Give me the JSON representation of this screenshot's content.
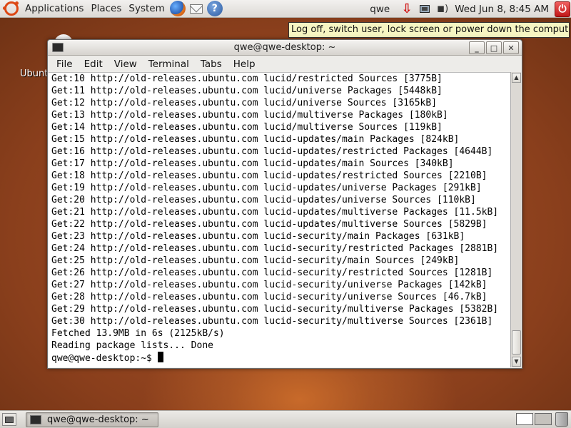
{
  "top_panel": {
    "menus": [
      "Applications",
      "Places",
      "System"
    ],
    "launchers": [
      "firefox-icon",
      "mail-icon",
      "help-icon"
    ],
    "user": "qwe",
    "clock": "Wed Jun  8,  8:45 AM",
    "tray_icons": [
      "download-arrow-icon",
      "network-icon",
      "volume-icon"
    ],
    "power_button": "shutdown-icon",
    "tooltip": "Log off, switch user, lock screen or power down the computer"
  },
  "desktop": {
    "icon_label": "Ubuntu"
  },
  "window": {
    "title": "qwe@qwe-desktop: ~",
    "menu": {
      "file": "File",
      "edit": "Edit",
      "view": "View",
      "terminal": "Terminal",
      "tabs": "Tabs",
      "help": "Help"
    },
    "lines": [
      "Get:10 http://old-releases.ubuntu.com lucid/restricted Sources [3775B]",
      "Get:11 http://old-releases.ubuntu.com lucid/universe Packages [5448kB]",
      "Get:12 http://old-releases.ubuntu.com lucid/universe Sources [3165kB]",
      "Get:13 http://old-releases.ubuntu.com lucid/multiverse Packages [180kB]",
      "Get:14 http://old-releases.ubuntu.com lucid/multiverse Sources [119kB]",
      "Get:15 http://old-releases.ubuntu.com lucid-updates/main Packages [824kB]",
      "Get:16 http://old-releases.ubuntu.com lucid-updates/restricted Packages [4644B]",
      "Get:17 http://old-releases.ubuntu.com lucid-updates/main Sources [340kB]",
      "Get:18 http://old-releases.ubuntu.com lucid-updates/restricted Sources [2210B]",
      "Get:19 http://old-releases.ubuntu.com lucid-updates/universe Packages [291kB]",
      "Get:20 http://old-releases.ubuntu.com lucid-updates/universe Sources [110kB]",
      "Get:21 http://old-releases.ubuntu.com lucid-updates/multiverse Packages [11.5kB]",
      "Get:22 http://old-releases.ubuntu.com lucid-updates/multiverse Sources [5829B]",
      "Get:23 http://old-releases.ubuntu.com lucid-security/main Packages [631kB]",
      "Get:24 http://old-releases.ubuntu.com lucid-security/restricted Packages [2881B]",
      "Get:25 http://old-releases.ubuntu.com lucid-security/main Sources [249kB]",
      "Get:26 http://old-releases.ubuntu.com lucid-security/restricted Sources [1281B]",
      "Get:27 http://old-releases.ubuntu.com lucid-security/universe Packages [142kB]",
      "Get:28 http://old-releases.ubuntu.com lucid-security/universe Sources [46.7kB]",
      "Get:29 http://old-releases.ubuntu.com lucid-security/multiverse Packages [5382B]",
      "Get:30 http://old-releases.ubuntu.com lucid-security/multiverse Sources [2361B]",
      "Fetched 13.9MB in 6s (2125kB/s)",
      "Reading package lists... Done"
    ],
    "prompt": "qwe@qwe-desktop:~$ "
  },
  "bottom_panel": {
    "task_label": "qwe@qwe-desktop: ~"
  }
}
